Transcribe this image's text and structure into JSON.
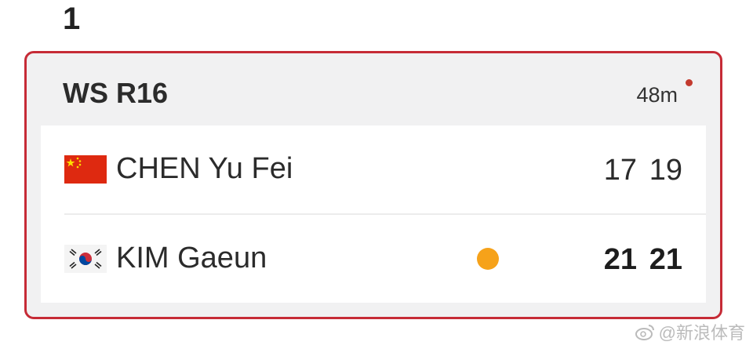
{
  "match_number": "1",
  "card": {
    "round": "WS R16",
    "duration": "48m",
    "colors": {
      "border": "#c62b36",
      "live_dot": "#c33a2e",
      "serve_dot": "#f6a21a"
    },
    "players": [
      {
        "name": "CHEN Yu Fei",
        "flag_icon": "china-flag-icon",
        "serving": false,
        "winner": false,
        "scores": [
          "17",
          "19"
        ]
      },
      {
        "name": "KIM Gaeun",
        "flag_icon": "south-korea-flag-icon",
        "serving": true,
        "winner": true,
        "scores": [
          "21",
          "21"
        ]
      }
    ]
  },
  "watermark": "@新浪体育"
}
